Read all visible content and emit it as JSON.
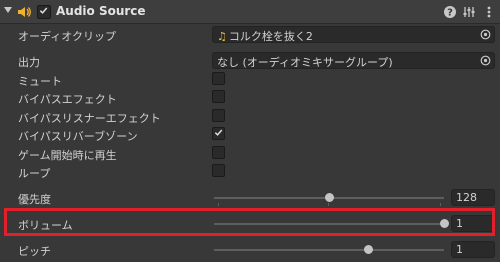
{
  "component": {
    "title": "Audio Source",
    "enabled": true,
    "icons": [
      "help-icon",
      "preset-icon",
      "menu-icon"
    ]
  },
  "fields": {
    "audio_clip": {
      "label": "オーディオクリップ",
      "value": "コルク栓を抜く2",
      "icon": "music-note-icon"
    },
    "output": {
      "label": "出力",
      "value": "なし (オーディオミキサーグループ)"
    },
    "mute": {
      "label": "ミュート",
      "checked": false
    },
    "bypass_effects": {
      "label": "バイパスエフェクト",
      "checked": false
    },
    "bypass_listener_effects": {
      "label": "バイパスリスナーエフェクト",
      "checked": false
    },
    "bypass_reverb_zones": {
      "label": "バイパスリバーブゾーン",
      "checked": true
    },
    "play_on_awake": {
      "label": "ゲーム開始時に再生",
      "checked": false
    },
    "loop": {
      "label": "ループ",
      "checked": false
    },
    "priority": {
      "label": "優先度",
      "value": "128",
      "fraction": 0.5
    },
    "volume": {
      "label": "ボリューム",
      "value": "1",
      "fraction": 1.0
    },
    "pitch": {
      "label": "ピッチ",
      "value": "1",
      "fraction": 0.67
    }
  },
  "colors": {
    "background": "#383838",
    "field": "#2a2a2a",
    "highlight": "#e0202a",
    "speaker": "#f0b030"
  }
}
